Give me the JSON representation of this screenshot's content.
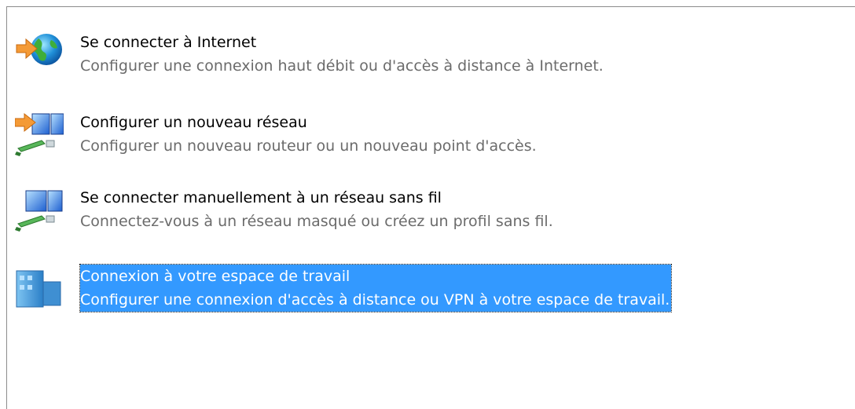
{
  "options": [
    {
      "title": "Se connecter à Internet",
      "description": "Configurer une connexion haut débit ou d'accès à distance à Internet.",
      "icon": "globe-connect-icon",
      "selected": false
    },
    {
      "title": "Configurer un nouveau réseau",
      "description": "Configurer un nouveau routeur ou un nouveau point d'accès.",
      "icon": "new-network-icon",
      "selected": false
    },
    {
      "title": "Se connecter manuellement à un réseau sans fil",
      "description": "Connectez-vous à un réseau masqué ou créez un profil sans fil.",
      "icon": "wireless-network-icon",
      "selected": false
    },
    {
      "title": "Connexion à votre espace de travail",
      "description": "Configurer une connexion d'accès à distance ou VPN à votre espace de travail.",
      "icon": "workplace-vpn-icon",
      "selected": true
    }
  ],
  "colors": {
    "selection": "#3399ff",
    "title_text": "#000000",
    "description_text": "#6b6b6b",
    "border": "#8c8c8c"
  }
}
